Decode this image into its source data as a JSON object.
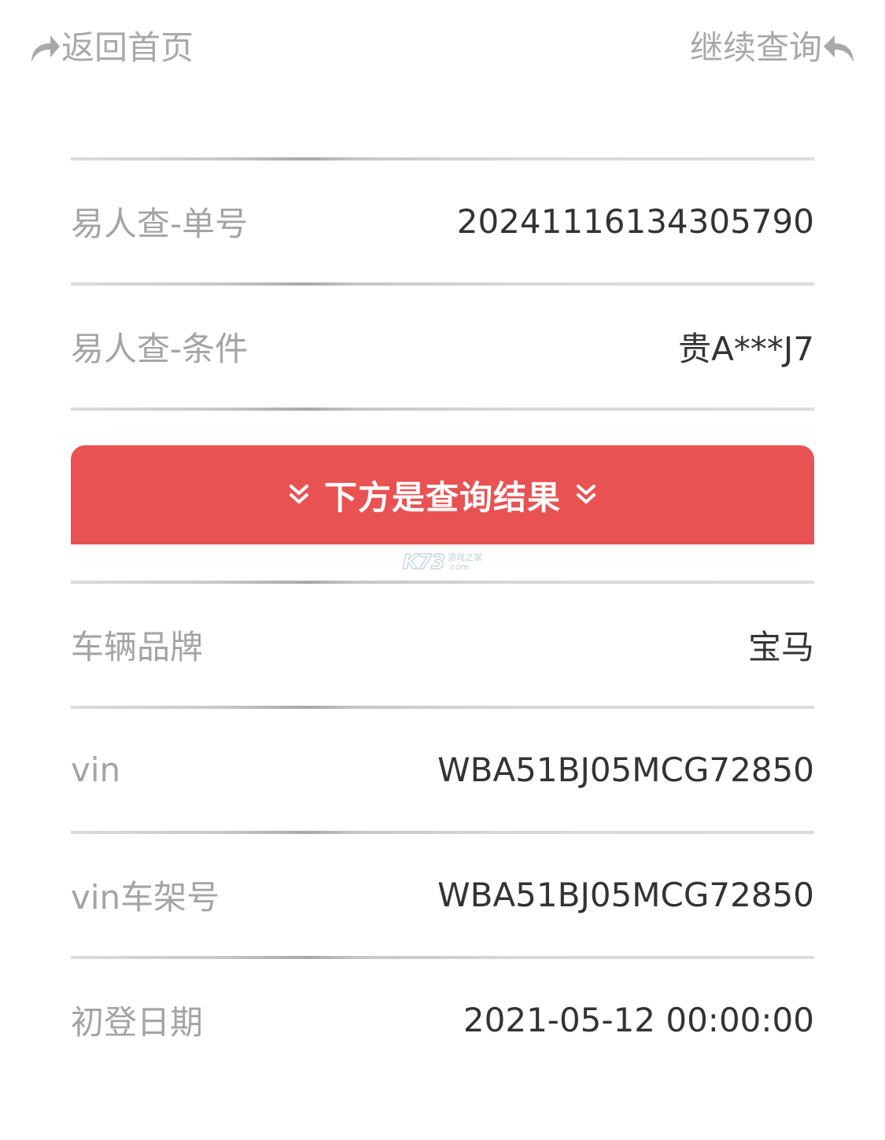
{
  "nav": {
    "back_home": "返回首页",
    "continue_query": "继续查询"
  },
  "query": {
    "order_label": "易人查-单号",
    "order_value": "20241116134305790",
    "condition_label": "易人查-条件",
    "condition_value": "贵A***J7"
  },
  "banner": {
    "text": "下方是查询结果",
    "color": "#e95252"
  },
  "watermark": {
    "logo": "K73",
    "line1": "游戏之家",
    "line2": ".com"
  },
  "results": [
    {
      "label": "车辆品牌",
      "value": "宝马"
    },
    {
      "label": "vin",
      "value": "WBA51BJ05MCG72850"
    },
    {
      "label": "vin车架号",
      "value": "WBA51BJ05MCG72850"
    },
    {
      "label": "初登日期",
      "value": "2021-05-12 00:00:00"
    }
  ]
}
